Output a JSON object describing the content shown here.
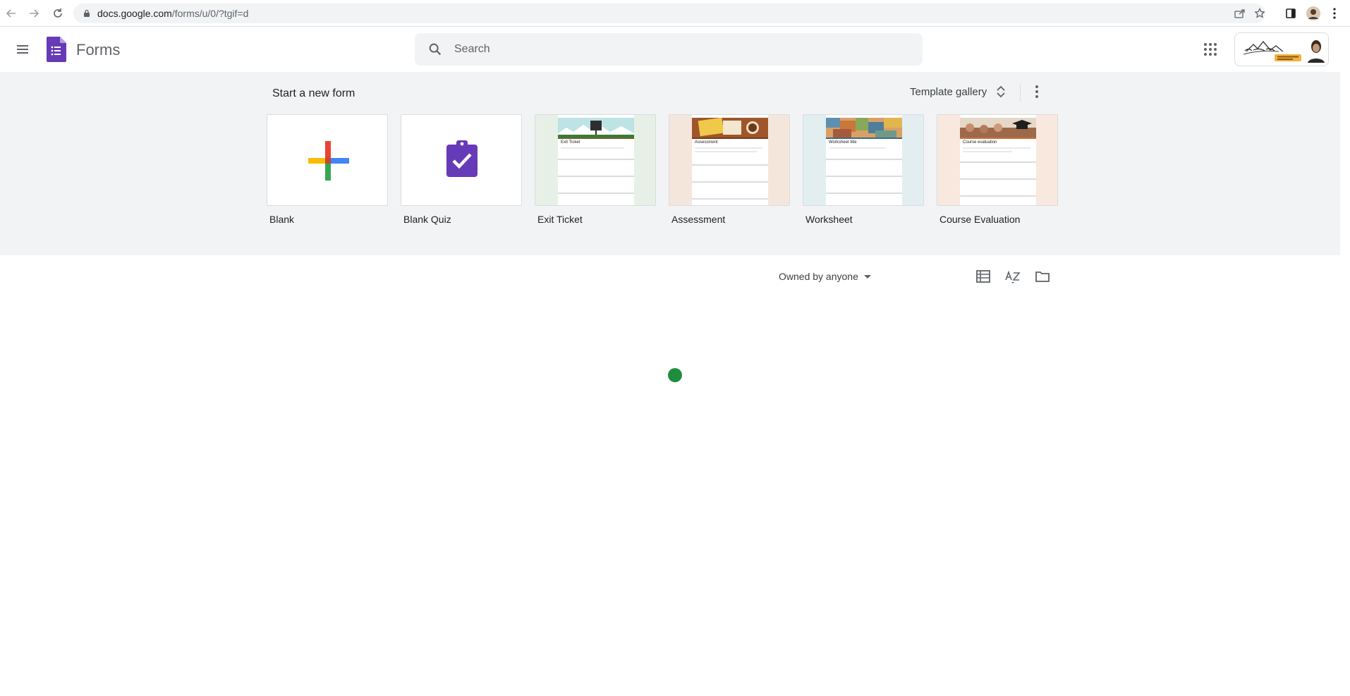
{
  "browser": {
    "url_host": "docs.google.com",
    "url_path": "/forms/u/0/?tgif=d"
  },
  "header": {
    "app_title": "Forms",
    "search_placeholder": "Search"
  },
  "templates": {
    "section_title": "Start a new form",
    "gallery_label": "Template gallery",
    "cards": [
      {
        "label": "Blank",
        "thumb_title": ""
      },
      {
        "label": "Blank Quiz",
        "thumb_title": ""
      },
      {
        "label": "Exit Ticket",
        "thumb_title": "Exit Ticket"
      },
      {
        "label": "Assessment",
        "thumb_title": "Assessment"
      },
      {
        "label": "Worksheet",
        "thumb_title": "Worksheet title"
      },
      {
        "label": "Course Evaluation",
        "thumb_title": "Course evaluation"
      }
    ]
  },
  "list": {
    "owner_filter": "Owned by anyone"
  },
  "colors": {
    "forms_purple": "#673ab7",
    "loader_green": "#1e8e3e",
    "header_bg": "#f1f3f4"
  },
  "icons": {
    "menu": "hamburger-menu-icon",
    "search": "search-icon",
    "apps": "apps-grid-icon",
    "more": "more-vert-icon",
    "list_view": "list-view-icon",
    "sort": "sort-az-icon",
    "folder": "folder-icon"
  }
}
